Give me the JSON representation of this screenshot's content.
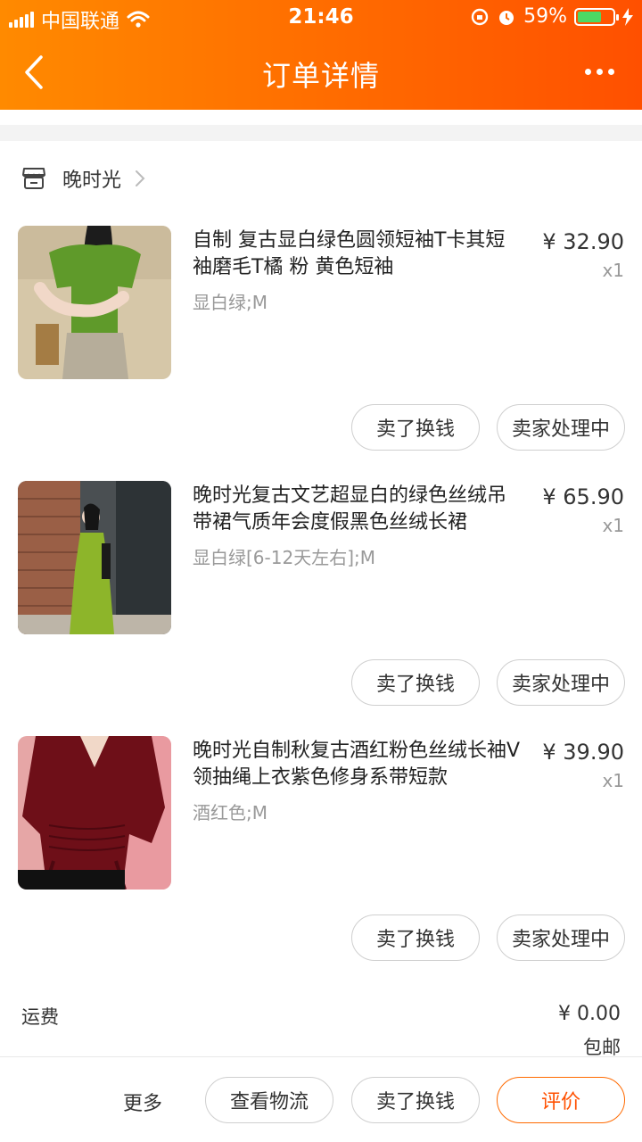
{
  "status_bar": {
    "carrier": "中国联通",
    "time": "21:46",
    "battery": "59%"
  },
  "nav": {
    "title": "订单详情"
  },
  "shop": {
    "name": "晚时光"
  },
  "items": [
    {
      "name": "自制 复古显白绿色圆领短袖T卡其短袖磨毛T橘 粉 黄色短袖",
      "spec": "显白绿;M",
      "price": "¥ 32.90",
      "qty": "x1",
      "sell_label": "卖了换钱",
      "seller_label": "卖家处理中"
    },
    {
      "name": "晚时光复古文艺超显白的绿色丝绒吊带裙气质年会度假黑色丝绒长裙",
      "spec": "显白绿[6-12天左右];M",
      "price": "¥ 65.90",
      "qty": "x1",
      "sell_label": "卖了换钱",
      "seller_label": "卖家处理中"
    },
    {
      "name": "晚时光自制秋复古酒红粉色丝绒长袖V领抽绳上衣紫色修身系带短款",
      "spec": "酒红色;M",
      "price": "¥ 39.90",
      "qty": "x1",
      "sell_label": "卖了换钱",
      "seller_label": "卖家处理中"
    }
  ],
  "shipping": {
    "label": "运费",
    "price": "¥ 0.00",
    "note": "包邮"
  },
  "bottom_bar": {
    "more": "更多",
    "logistics": "查看物流",
    "sell": "卖了换钱",
    "review": "评价"
  },
  "colors": {
    "accent": "#ff6a00",
    "header_start": "#ff8a00",
    "header_end": "#ff5000"
  }
}
